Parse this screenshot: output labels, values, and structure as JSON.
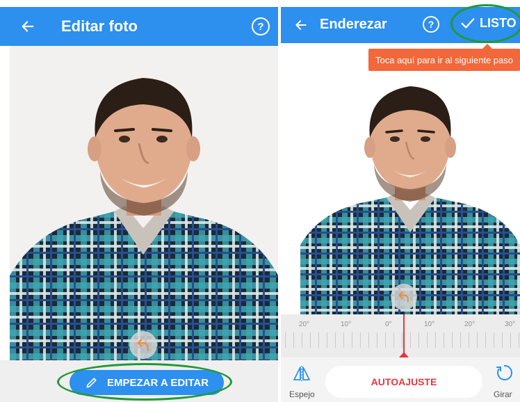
{
  "left_screen": {
    "header": {
      "back_icon": "arrow-left-icon",
      "title": "Editar foto",
      "help_label": "?"
    },
    "start_button": {
      "icon": "pencil-icon",
      "label": "EMPEZAR A EDITAR"
    }
  },
  "right_screen": {
    "header": {
      "back_icon": "arrow-left-icon",
      "title": "Enderezar",
      "help_label": "?",
      "done_icon": "check-icon",
      "done_label": "LISTO"
    },
    "tooltip": "Toca aquí para ir al siguiente paso",
    "ruler": {
      "labels": [
        "20°",
        "10°",
        "0°",
        "10°",
        "20°",
        "30°"
      ],
      "angle_value": 0
    },
    "bottom": {
      "mirror_label": "Espejo",
      "auto_label": "AUTOAJUSTE",
      "rotate_label": "Girar"
    }
  },
  "colors": {
    "primary": "#2d8fee",
    "accent_red": "#e8363d",
    "tooltip": "#f2683a",
    "highlight_ring": "#1f9a36"
  }
}
